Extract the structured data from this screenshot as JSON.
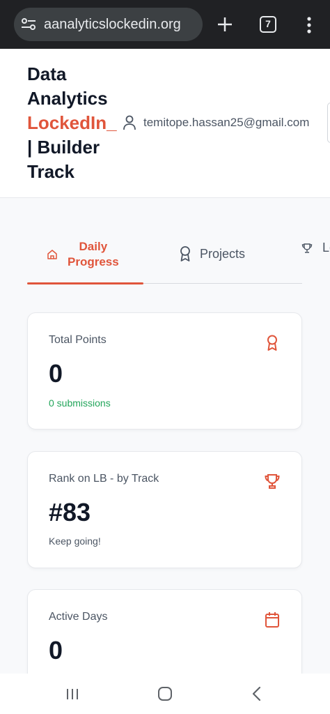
{
  "browser": {
    "url": "aanalyticslockedin.org",
    "tab_count": "7"
  },
  "header": {
    "title_line1": "Data",
    "title_line2": "Analytics",
    "title_accent": "LockedIn_",
    "title_line4": "| Builder",
    "title_line5": "Track",
    "user_email": "temitope.hassan25@gmail.com"
  },
  "tabs": {
    "daily_line1": "Daily",
    "daily_line2": "Progress",
    "projects": "Projects",
    "leaderboard_partial": "Le"
  },
  "cards": {
    "total_points": {
      "label": "Total Points",
      "value": "0",
      "sub": "0 submissions"
    },
    "rank": {
      "label": "Rank on LB - by Track",
      "value": "#83",
      "sub": "Keep going!"
    },
    "active_days": {
      "label": "Active Days",
      "value": "0"
    }
  },
  "colors": {
    "accent": "#e0553b",
    "success": "#22a55a",
    "text_dark": "#111827",
    "text_muted": "#4b5563"
  },
  "icons": {
    "home": "home-icon",
    "projects": "award-icon",
    "leaderboard": "trophy-icon",
    "points": "award-icon",
    "rank": "trophy-icon",
    "days": "calendar-icon",
    "user": "user-icon"
  }
}
